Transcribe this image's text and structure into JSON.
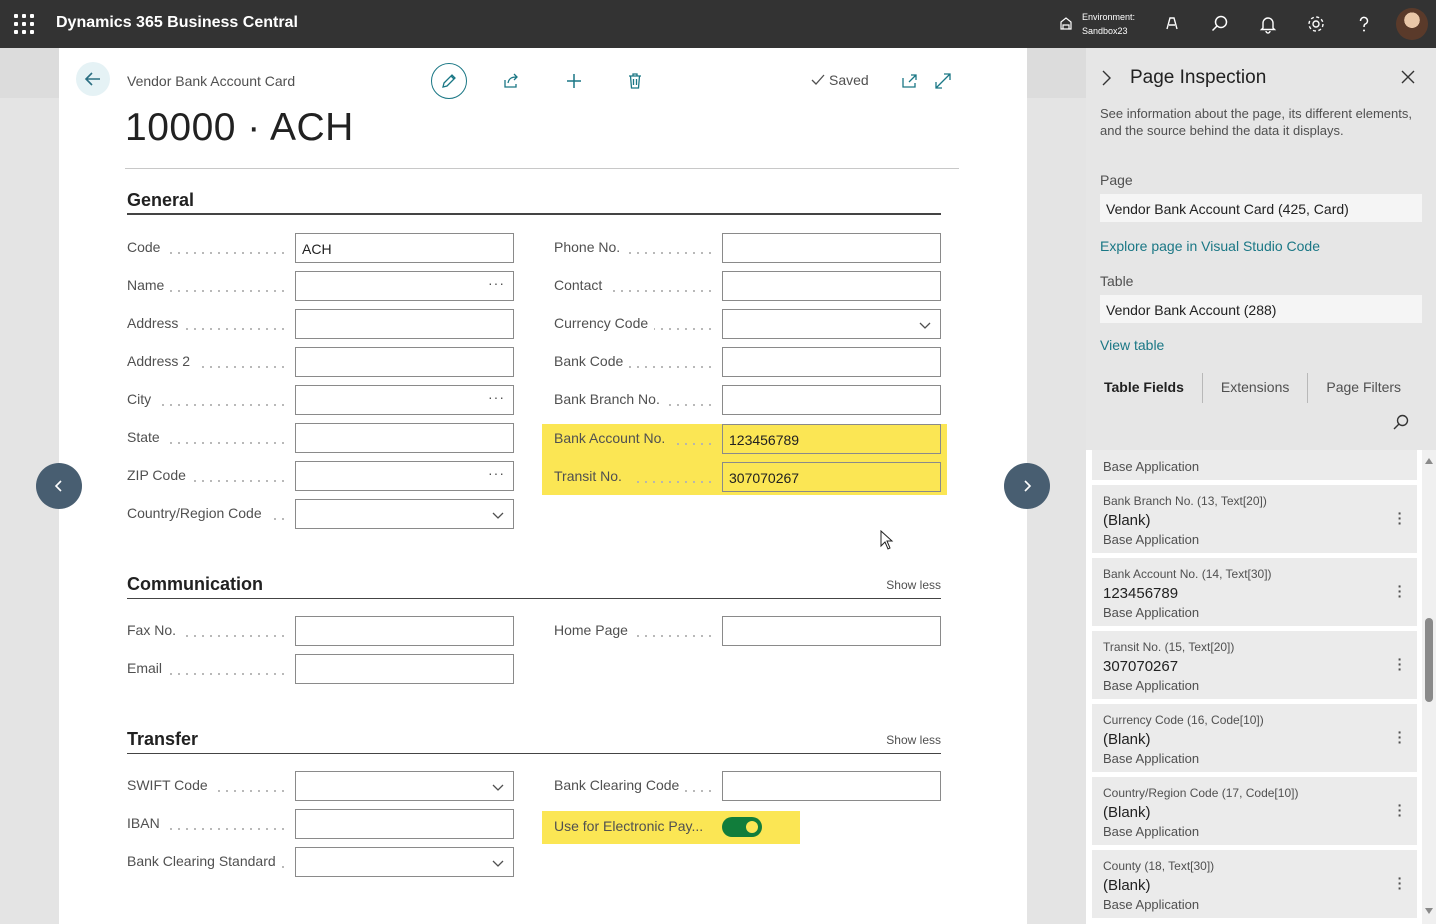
{
  "topbar": {
    "app_title": "Dynamics 365 Business Central",
    "env_label": "Environment:",
    "env_name": "Sandbox23"
  },
  "card": {
    "breadcrumb": "Vendor Bank Account Card",
    "saved_label": "Saved",
    "title": "10000 · ACH",
    "general": {
      "title": "General",
      "left_fields": [
        {
          "label": "Code",
          "value": "ACH"
        },
        {
          "label": "Name",
          "value": ""
        },
        {
          "label": "Address",
          "value": ""
        },
        {
          "label": "Address 2",
          "value": ""
        },
        {
          "label": "City",
          "value": ""
        },
        {
          "label": "State",
          "value": ""
        },
        {
          "label": "ZIP Code",
          "value": ""
        },
        {
          "label": "Country/Region Code",
          "value": ""
        }
      ],
      "right_fields": [
        {
          "label": "Phone No.",
          "value": ""
        },
        {
          "label": "Contact",
          "value": ""
        },
        {
          "label": "Currency Code",
          "value": ""
        },
        {
          "label": "Bank Code",
          "value": ""
        },
        {
          "label": "Bank Branch No.",
          "value": ""
        },
        {
          "label": "Bank Account No.",
          "value": "123456789"
        },
        {
          "label": "Transit No.",
          "value": "307070267"
        }
      ]
    },
    "communication": {
      "title": "Communication",
      "show_less": "Show less",
      "fields": [
        {
          "label": "Fax No.",
          "value": ""
        },
        {
          "label": "Email",
          "value": ""
        },
        {
          "label": "Home Page",
          "value": ""
        }
      ]
    },
    "transfer": {
      "title": "Transfer",
      "show_less": "Show less",
      "fields": [
        {
          "label": "SWIFT Code",
          "value": ""
        },
        {
          "label": "IBAN",
          "value": ""
        },
        {
          "label": "Bank Clearing Standard",
          "value": ""
        },
        {
          "label": "Bank Clearing Code",
          "value": ""
        },
        {
          "label": "Use for Electronic Pay...",
          "value": ""
        }
      ],
      "electronic_pay_on": true
    }
  },
  "panel": {
    "title": "Page Inspection",
    "description": "See information about the page, its different elements, and the source behind the data it displays.",
    "page_label": "Page",
    "page_value": "Vendor Bank Account Card (425, Card)",
    "page_link": "Explore page in Visual Studio Code",
    "table_label": "Table",
    "table_value": "Vendor Bank Account (288)",
    "table_link": "View table",
    "tabs": [
      "Table Fields",
      "Extensions",
      "Page Filters"
    ],
    "partial_item_src": "Base Application",
    "items": [
      {
        "head": "Bank Branch No. (13, Text[20])",
        "value": "(Blank)",
        "src": "Base Application"
      },
      {
        "head": "Bank Account No. (14, Text[30])",
        "value": "123456789",
        "src": "Base Application"
      },
      {
        "head": "Transit No. (15, Text[20])",
        "value": "307070267",
        "src": "Base Application"
      },
      {
        "head": "Currency Code (16, Code[10])",
        "value": "(Blank)",
        "src": "Base Application"
      },
      {
        "head": "Country/Region Code (17, Code[10])",
        "value": "(Blank)",
        "src": "Base Application"
      },
      {
        "head": "County (18, Text[30])",
        "value": "(Blank)",
        "src": "Base Application"
      }
    ]
  },
  "colors": {
    "topbar": "#333333",
    "accent": "#1a7785",
    "highlight": "#fbe654",
    "toggle_on": "#117d3b"
  }
}
